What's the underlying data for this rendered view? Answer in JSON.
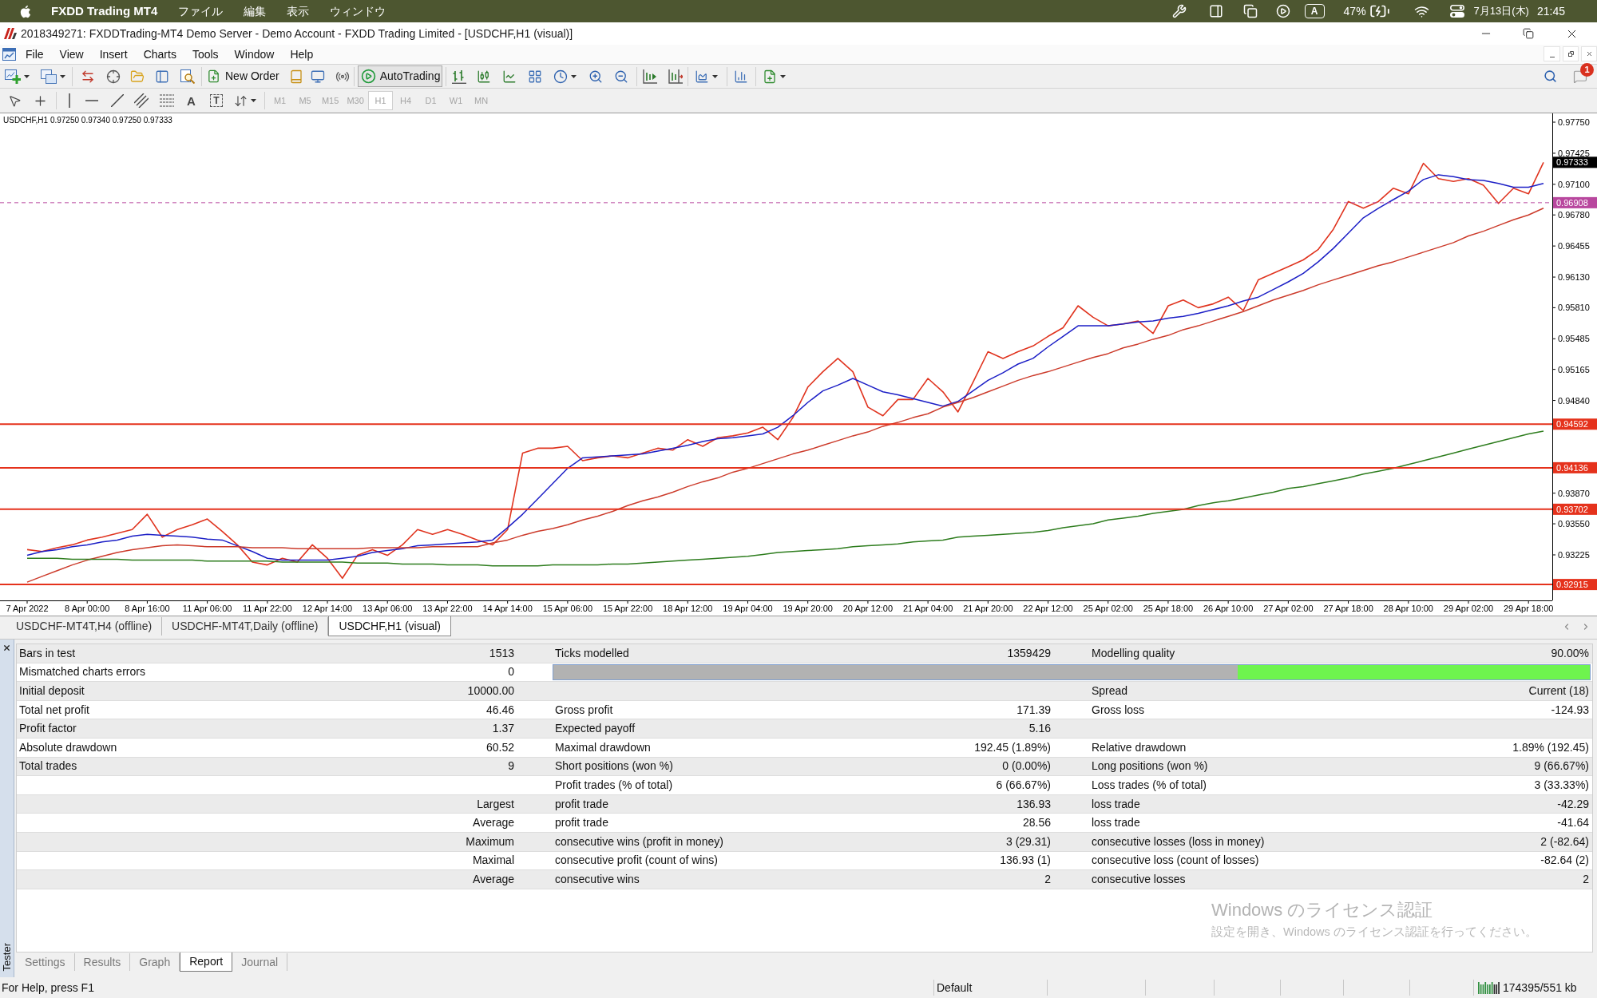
{
  "system_menu_bar": {
    "app_name": "FXDD Trading MT4",
    "menus": [
      "ファイル",
      "編集",
      "表示",
      "ウィンドウ"
    ],
    "input_source": "A",
    "battery": "47%",
    "date": "7月13日(木)",
    "time": "21:45"
  },
  "window": {
    "title": "2018349271: FXDDTrading-MT4 Demo Server - Demo Account - FXDD Trading Limited - [USDCHF,H1 (visual)]"
  },
  "menu": [
    "File",
    "View",
    "Insert",
    "Charts",
    "Tools",
    "Window",
    "Help"
  ],
  "toolbar": {
    "new_order": "New Order",
    "autotrading": {
      "label": "AutoTrading",
      "on": true
    },
    "notification_count": "1"
  },
  "drawing_toolbar": {
    "text_tool": "A",
    "label_tool": "T",
    "periods_disabled": true,
    "periods": [
      {
        "label": "M1",
        "selected": false
      },
      {
        "label": "M5",
        "selected": false
      },
      {
        "label": "M15",
        "selected": false
      },
      {
        "label": "M30",
        "selected": false
      },
      {
        "label": "H1",
        "selected": true
      },
      {
        "label": "H4",
        "selected": false
      },
      {
        "label": "D1",
        "selected": false
      },
      {
        "label": "W1",
        "selected": false
      },
      {
        "label": "MN",
        "selected": false
      }
    ]
  },
  "chart": {
    "chart_data": {
      "type": "line",
      "title": "USDCHF,H1 0.97250 0.97340 0.97250 0.97333",
      "categories": [
        "7 Apr 2022",
        null,
        null,
        null,
        "8 Apr 00:00",
        null,
        null,
        null,
        "8 Apr 16:00",
        null,
        null,
        null,
        "11 Apr 06:00",
        null,
        null,
        null,
        "11 Apr 22:00",
        null,
        null,
        null,
        "12 Apr 14:00",
        null,
        null,
        null,
        "13 Apr 06:00",
        null,
        null,
        null,
        "13 Apr 22:00",
        null,
        null,
        null,
        "14 Apr 14:00",
        null,
        null,
        null,
        "15 Apr 06:00",
        null,
        null,
        null,
        "15 Apr 22:00",
        null,
        null,
        null,
        "18 Apr 12:00",
        null,
        null,
        null,
        "19 Apr 04:00",
        null,
        null,
        null,
        "19 Apr 20:00",
        null,
        null,
        null,
        "20 Apr 12:00",
        null,
        null,
        null,
        "21 Apr 04:00",
        null,
        null,
        null,
        "21 Apr 20:00",
        null,
        null,
        null,
        "22 Apr 12:00",
        null,
        null,
        null,
        "25 Apr 02:00",
        null,
        null,
        null,
        "25 Apr 18:00",
        null,
        null,
        null,
        "26 Apr 10:00",
        null,
        null,
        null,
        "27 Apr 02:00",
        null,
        null,
        null,
        "27 Apr 18:00",
        null,
        null,
        null,
        "28 Apr 10:00",
        null,
        null,
        null,
        "29 Apr 02:00",
        null,
        null,
        null,
        "29 Apr 18:00",
        null
      ],
      "ylim": [
        0.92749,
        0.97842
      ],
      "yticks": [
        {
          "value": 0.9775,
          "label": "0.97750"
        },
        {
          "value": 0.97425,
          "label": "0.97425"
        },
        {
          "value": 0.971,
          "label": "0.97100"
        },
        {
          "value": 0.9678,
          "label": "0.96780"
        },
        {
          "value": 0.96455,
          "label": "0.96455"
        },
        {
          "value": 0.9613,
          "label": "0.96130"
        },
        {
          "value": 0.9581,
          "label": "0.95810"
        },
        {
          "value": 0.95485,
          "label": "0.95485"
        },
        {
          "value": 0.95165,
          "label": "0.95165"
        },
        {
          "value": 0.9484,
          "label": "0.94840"
        },
        {
          "value": 0.9387,
          "label": "0.93870"
        },
        {
          "value": 0.9355,
          "label": "0.93550"
        },
        {
          "value": 0.93225,
          "label": "0.93225"
        }
      ],
      "series": [
        {
          "color": "#e0341f",
          "values": [
            0.9328,
            0.9326,
            0.933,
            0.9333,
            0.9338,
            0.9341,
            0.9345,
            0.9349,
            0.9365,
            0.9341,
            0.9349,
            0.9354,
            0.936,
            0.9347,
            0.9333,
            0.9315,
            0.9312,
            0.9319,
            0.9315,
            0.9333,
            0.9319,
            0.9298,
            0.9322,
            0.9328,
            0.9322,
            0.9333,
            0.9349,
            0.9344,
            0.9349,
            0.9344,
            0.9338,
            0.9333,
            0.9349,
            0.9429,
            0.9434,
            0.9434,
            0.9436,
            0.9421,
            0.9424,
            0.9426,
            0.9424,
            0.9429,
            0.9434,
            0.9432,
            0.9443,
            0.9436,
            0.9445,
            0.9447,
            0.945,
            0.9456,
            0.9443,
            0.9466,
            0.9498,
            0.9514,
            0.9528,
            0.9514,
            0.9477,
            0.9468,
            0.9485,
            0.9485,
            0.9507,
            0.9493,
            0.9472,
            0.9503,
            0.9535,
            0.9528,
            0.9535,
            0.9541,
            0.9551,
            0.956,
            0.9583,
            0.9571,
            0.9562,
            0.9564,
            0.9567,
            0.9554,
            0.9583,
            0.9589,
            0.9581,
            0.9585,
            0.9592,
            0.9578,
            0.961,
            0.9617,
            0.9624,
            0.9631,
            0.9642,
            0.9663,
            0.9692,
            0.9685,
            0.9692,
            0.9706,
            0.97,
            0.9732,
            0.9716,
            0.9713,
            0.9716,
            0.9709,
            0.969,
            0.9706,
            0.97,
            0.9733
          ]
        },
        {
          "color": "#1c1fc6",
          "values": [
            0.9322,
            0.9326,
            0.9328,
            0.9331,
            0.9333,
            0.9336,
            0.9338,
            0.9342,
            0.9344,
            0.9343,
            0.9342,
            0.9341,
            0.9339,
            0.9338,
            0.9332,
            0.9326,
            0.9319,
            0.9317,
            0.9317,
            0.9317,
            0.9317,
            0.9319,
            0.9321,
            0.9325,
            0.9327,
            0.9329,
            0.9332,
            0.9333,
            0.9334,
            0.9335,
            0.9336,
            0.9338,
            0.9351,
            0.9365,
            0.9381,
            0.9397,
            0.9413,
            0.9424,
            0.9425,
            0.9426,
            0.9427,
            0.9428,
            0.9431,
            0.9434,
            0.9437,
            0.9441,
            0.9444,
            0.9445,
            0.9447,
            0.9449,
            0.9456,
            0.9468,
            0.9482,
            0.9494,
            0.95,
            0.9507,
            0.95,
            0.9493,
            0.949,
            0.9486,
            0.9482,
            0.9478,
            0.9483,
            0.9494,
            0.9505,
            0.9513,
            0.9522,
            0.9528,
            0.954,
            0.9551,
            0.9562,
            0.9562,
            0.9562,
            0.9564,
            0.9566,
            0.9567,
            0.957,
            0.9572,
            0.9575,
            0.9579,
            0.9583,
            0.9588,
            0.9592,
            0.96,
            0.9608,
            0.9617,
            0.9629,
            0.9643,
            0.9659,
            0.9675,
            0.9685,
            0.9694,
            0.9703,
            0.9715,
            0.972,
            0.9718,
            0.9715,
            0.9714,
            0.9711,
            0.9707,
            0.9707,
            0.9711
          ]
        },
        {
          "color": "#cc3b2b",
          "values": [
            0.9294,
            0.93,
            0.9306,
            0.9312,
            0.9317,
            0.9321,
            0.9325,
            0.9328,
            0.933,
            0.9332,
            0.9333,
            0.9332,
            0.9331,
            0.9331,
            0.9331,
            0.933,
            0.933,
            0.933,
            0.9329,
            0.9329,
            0.9329,
            0.9329,
            0.9329,
            0.933,
            0.933,
            0.933,
            0.933,
            0.9331,
            0.9331,
            0.9331,
            0.9331,
            0.9335,
            0.9338,
            0.9343,
            0.9347,
            0.935,
            0.9354,
            0.9359,
            0.9363,
            0.9368,
            0.9374,
            0.9379,
            0.9383,
            0.9388,
            0.9394,
            0.9399,
            0.9403,
            0.9409,
            0.9413,
            0.9418,
            0.9423,
            0.9428,
            0.9432,
            0.9437,
            0.9442,
            0.9447,
            0.9451,
            0.9457,
            0.9461,
            0.9466,
            0.947,
            0.9477,
            0.9482,
            0.9487,
            0.9493,
            0.9499,
            0.9505,
            0.951,
            0.9514,
            0.9519,
            0.9524,
            0.9529,
            0.9533,
            0.9539,
            0.9543,
            0.9548,
            0.9552,
            0.9558,
            0.9562,
            0.9567,
            0.9572,
            0.9577,
            0.9583,
            0.9589,
            0.9594,
            0.9599,
            0.9605,
            0.961,
            0.9615,
            0.962,
            0.9625,
            0.9629,
            0.9634,
            0.9639,
            0.9644,
            0.9649,
            0.9656,
            0.9661,
            0.9667,
            0.9673,
            0.9678,
            0.9685
          ]
        },
        {
          "color": "#2e7d1e",
          "values": [
            0.9319,
            0.9319,
            0.9319,
            0.9318,
            0.9318,
            0.9318,
            0.9318,
            0.9317,
            0.9317,
            0.9317,
            0.9317,
            0.9317,
            0.9316,
            0.9316,
            0.9316,
            0.9316,
            0.9316,
            0.9315,
            0.9315,
            0.9315,
            0.9315,
            0.9315,
            0.9314,
            0.9314,
            0.9314,
            0.9313,
            0.9313,
            0.9313,
            0.9312,
            0.9312,
            0.9312,
            0.9311,
            0.9311,
            0.9311,
            0.9311,
            0.9312,
            0.9312,
            0.9312,
            0.9312,
            0.9313,
            0.9313,
            0.9314,
            0.9315,
            0.9316,
            0.9317,
            0.9318,
            0.9319,
            0.932,
            0.9321,
            0.9323,
            0.9325,
            0.9326,
            0.9327,
            0.9328,
            0.9329,
            0.9331,
            0.9332,
            0.9333,
            0.9334,
            0.9336,
            0.9337,
            0.9338,
            0.9341,
            0.9342,
            0.9343,
            0.9344,
            0.9345,
            0.9346,
            0.9348,
            0.9351,
            0.9353,
            0.9355,
            0.9359,
            0.9361,
            0.9363,
            0.9366,
            0.9368,
            0.937,
            0.9374,
            0.9377,
            0.9379,
            0.9382,
            0.9385,
            0.9388,
            0.9392,
            0.9394,
            0.9397,
            0.94,
            0.9403,
            0.9407,
            0.941,
            0.9413,
            0.9417,
            0.9421,
            0.9425,
            0.9429,
            0.9433,
            0.9437,
            0.9441,
            0.9445,
            0.9449,
            0.9452
          ]
        }
      ],
      "ref_lines": [
        {
          "axis": "y",
          "value": 0.96908,
          "label": "0.96908",
          "color": "#b8479e"
        },
        {
          "axis": "y",
          "value": 0.94592,
          "label": "0.94592",
          "color": "#e5321c"
        },
        {
          "axis": "y",
          "value": 0.94136,
          "label": "0.94136",
          "color": "#e5321c"
        },
        {
          "axis": "y",
          "value": 0.93702,
          "label": "0.93702",
          "color": "#e5321c"
        },
        {
          "axis": "y",
          "value": 0.92915,
          "label": "0.92915",
          "color": "#e5321c"
        }
      ],
      "annotations": [
        "0.97333"
      ]
    }
  },
  "chart_tabs": [
    {
      "label": "USDCHF-MT4T,H4 (offline)",
      "selected": false
    },
    {
      "label": "USDCHF-MT4T,Daily (offline)",
      "selected": false
    },
    {
      "label": "USDCHF,H1 (visual)",
      "selected": true
    }
  ],
  "tester": {
    "panel_title": "Tester",
    "report": {
      "rows": [
        {
          "column_1": "Bars in test",
          "column_2": "1513",
          "column_3": "Ticks modelled",
          "column_4": "1359429",
          "column_5": "Modelling quality",
          "column_6": "90.00%"
        },
        {
          "column_1": "Mismatched charts errors",
          "column_2": "0",
          "quality_bar": {
            "level": 0.34
          }
        },
        {
          "column_1": "Initial deposit",
          "column_2": "10000.00",
          "column_5": "Spread",
          "column_6": "Current (18)"
        },
        {
          "column_1": "Total net profit",
          "column_2": "46.46",
          "column_3": "Gross profit",
          "column_4": "171.39",
          "column_5": "Gross loss",
          "column_6": "-124.93"
        },
        {
          "column_1": "Profit factor",
          "column_2": "1.37",
          "column_3": "Expected payoff",
          "column_4": "5.16"
        },
        {
          "column_1": "Absolute drawdown",
          "column_2": "60.52",
          "column_3": "Maximal drawdown",
          "column_4": "192.45 (1.89%)",
          "column_5": "Relative drawdown",
          "column_6": "1.89% (192.45)"
        },
        {
          "column_1": "Total trades",
          "column_2": "9",
          "column_3": "Short positions (won %)",
          "column_4": "0 (0.00%)",
          "column_5": "Long positions (won %)",
          "column_6": "9 (66.67%)"
        },
        {
          "column_3": "Profit trades (% of total)",
          "column_4": "6 (66.67%)",
          "column_5": "Loss trades (% of total)",
          "column_6": "3 (33.33%)"
        },
        {
          "column_2": "Largest",
          "column_3": "profit trade",
          "column_4": "136.93",
          "column_5": "loss trade",
          "column_6": "-42.29"
        },
        {
          "column_2": "Average",
          "column_3": "profit trade",
          "column_4": "28.56",
          "column_5": "loss trade",
          "column_6": "-41.64"
        },
        {
          "column_2": "Maximum",
          "column_3": "consecutive wins (profit in money)",
          "column_4": "3 (29.31)",
          "column_5": "consecutive losses (loss in money)",
          "column_6": "2 (-82.64)"
        },
        {
          "column_2": "Maximal",
          "column_3": "consecutive profit (count of wins)",
          "column_4": "136.93 (1)",
          "column_5": "consecutive loss (count of losses)",
          "column_6": "-82.64 (2)"
        },
        {
          "column_2": "Average",
          "column_3": "consecutive wins",
          "column_4": "2",
          "column_5": "consecutive losses",
          "column_6": "2"
        }
      ]
    },
    "tabs": [
      {
        "label": "Settings",
        "selected": false
      },
      {
        "label": "Results",
        "selected": false
      },
      {
        "label": "Graph",
        "selected": false
      },
      {
        "label": "Report",
        "selected": true
      },
      {
        "label": "Journal",
        "selected": false
      }
    ]
  },
  "activation_notice": {
    "title": "Windows のライセンス認証",
    "message": "設定を開き、Windows のライセンス認証を行ってください。"
  },
  "status_bar": {
    "help": "For Help, press F1",
    "profile": "Default",
    "traffic": "174395/551 kb"
  }
}
